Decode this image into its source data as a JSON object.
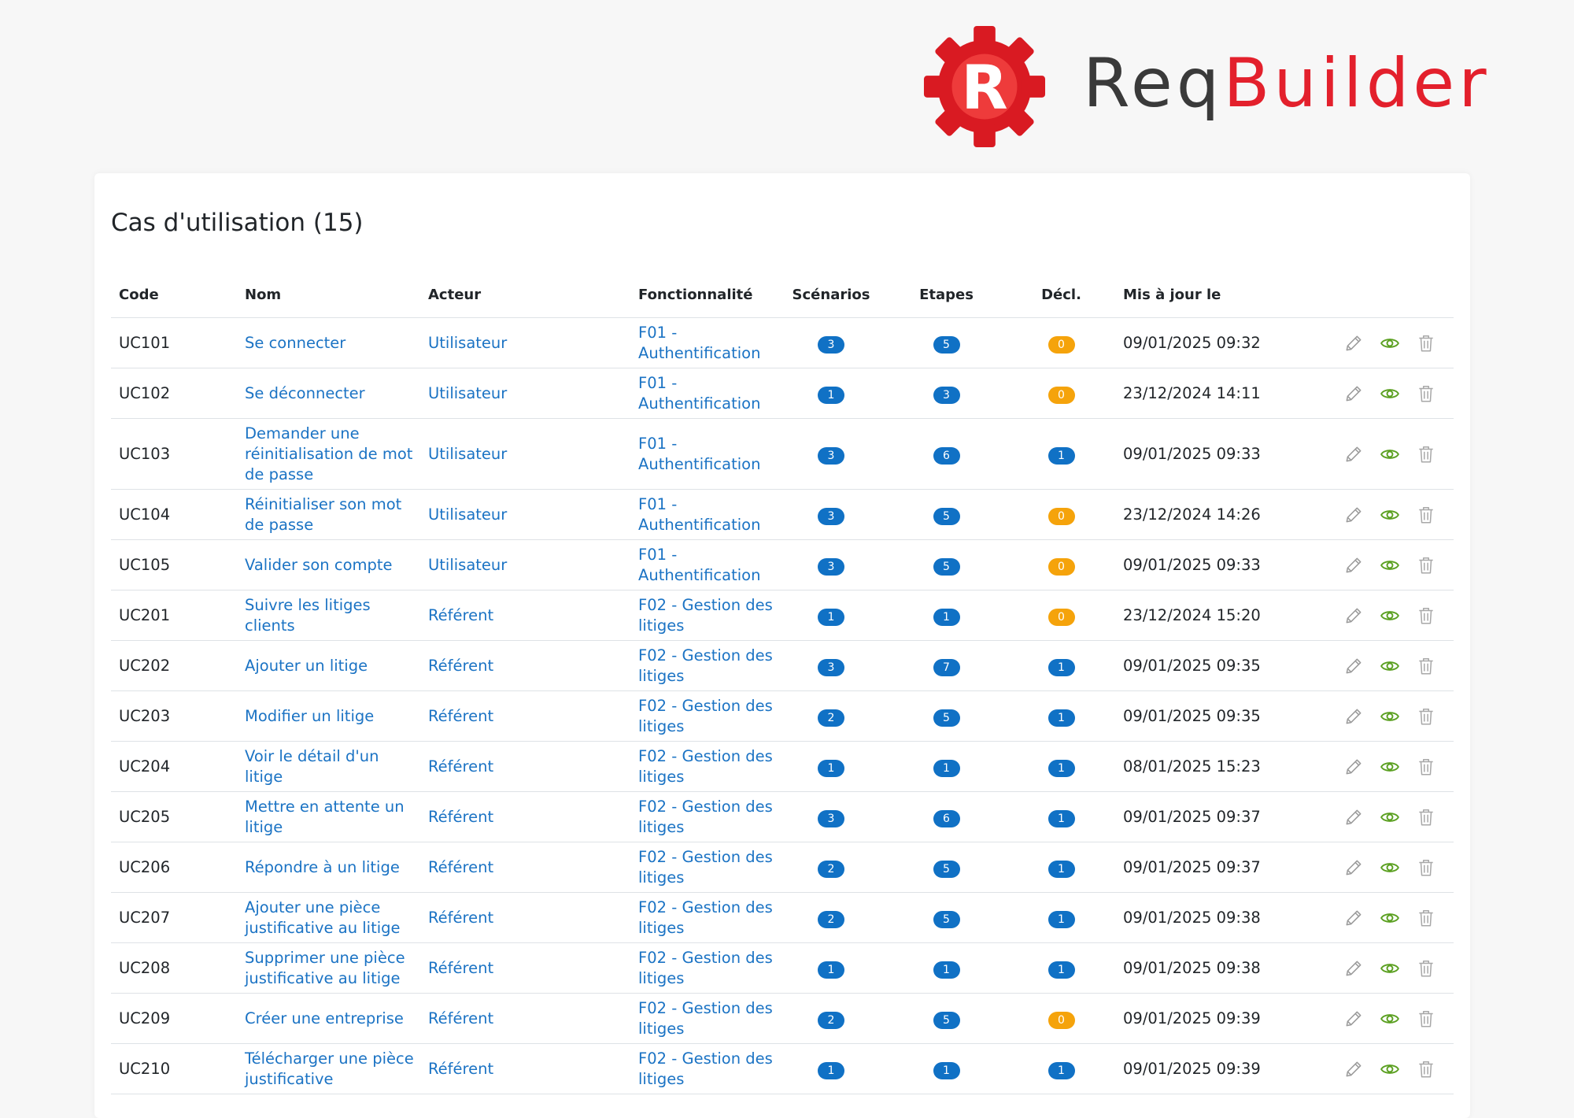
{
  "brand": {
    "req": "Req",
    "builder": "Builder",
    "letter": "R",
    "red": "#e3202c",
    "dark": "#3a3a3a"
  },
  "colors": {
    "link": "#1b73c4",
    "badge_blue": "#1071c5",
    "badge_orange": "#f5a30b",
    "view_green": "#5ba021"
  },
  "page": {
    "title": "Cas d'utilisation (15)"
  },
  "table": {
    "headers": [
      "Code",
      "Nom",
      "Acteur",
      "Fonctionnalité",
      "Scénarios",
      "Etapes",
      "Décl.",
      "Mis à jour le"
    ],
    "rows": [
      {
        "code": "UC101",
        "name": "Se connecter",
        "actor": "Utilisateur",
        "feature": "F01 - Authentification",
        "scenarios": "3",
        "steps": "5",
        "decl": "0",
        "updated": "09/01/2025 09:32"
      },
      {
        "code": "UC102",
        "name": "Se déconnecter",
        "actor": "Utilisateur",
        "feature": "F01 - Authentification",
        "scenarios": "1",
        "steps": "3",
        "decl": "0",
        "updated": "23/12/2024 14:11"
      },
      {
        "code": "UC103",
        "name": "Demander une réinitialisation de mot de passe",
        "actor": "Utilisateur",
        "feature": "F01 - Authentification",
        "scenarios": "3",
        "steps": "6",
        "decl": "1",
        "updated": "09/01/2025 09:33"
      },
      {
        "code": "UC104",
        "name": "Réinitialiser son mot de passe",
        "actor": "Utilisateur",
        "feature": "F01 - Authentification",
        "scenarios": "3",
        "steps": "5",
        "decl": "0",
        "updated": "23/12/2024 14:26"
      },
      {
        "code": "UC105",
        "name": "Valider son compte",
        "actor": "Utilisateur",
        "feature": "F01 - Authentification",
        "scenarios": "3",
        "steps": "5",
        "decl": "0",
        "updated": "09/01/2025 09:33"
      },
      {
        "code": "UC201",
        "name": "Suivre les litiges clients",
        "actor": "Référent",
        "feature": "F02 - Gestion des litiges",
        "scenarios": "1",
        "steps": "1",
        "decl": "0",
        "updated": "23/12/2024 15:20"
      },
      {
        "code": "UC202",
        "name": "Ajouter un litige",
        "actor": "Référent",
        "feature": "F02 - Gestion des litiges",
        "scenarios": "3",
        "steps": "7",
        "decl": "1",
        "updated": "09/01/2025 09:35"
      },
      {
        "code": "UC203",
        "name": "Modifier un litige",
        "actor": "Référent",
        "feature": "F02 - Gestion des litiges",
        "scenarios": "2",
        "steps": "5",
        "decl": "1",
        "updated": "09/01/2025 09:35"
      },
      {
        "code": "UC204",
        "name": "Voir le détail d'un litige",
        "actor": "Référent",
        "feature": "F02 - Gestion des litiges",
        "scenarios": "1",
        "steps": "1",
        "decl": "1",
        "updated": "08/01/2025 15:23"
      },
      {
        "code": "UC205",
        "name": "Mettre en attente un litige",
        "actor": "Référent",
        "feature": "F02 - Gestion des litiges",
        "scenarios": "3",
        "steps": "6",
        "decl": "1",
        "updated": "09/01/2025 09:37"
      },
      {
        "code": "UC206",
        "name": "Répondre à un litige",
        "actor": "Référent",
        "feature": "F02 - Gestion des litiges",
        "scenarios": "2",
        "steps": "5",
        "decl": "1",
        "updated": "09/01/2025 09:37"
      },
      {
        "code": "UC207",
        "name": "Ajouter une pièce justificative au litige",
        "actor": "Référent",
        "feature": "F02 - Gestion des litiges",
        "scenarios": "2",
        "steps": "5",
        "decl": "1",
        "updated": "09/01/2025 09:38"
      },
      {
        "code": "UC208",
        "name": "Supprimer une pièce justificative au litige",
        "actor": "Référent",
        "feature": "F02 - Gestion des litiges",
        "scenarios": "1",
        "steps": "1",
        "decl": "1",
        "updated": "09/01/2025 09:38"
      },
      {
        "code": "UC209",
        "name": "Créer une entreprise",
        "actor": "Référent",
        "feature": "F02 - Gestion des litiges",
        "scenarios": "2",
        "steps": "5",
        "decl": "0",
        "updated": "09/01/2025 09:39"
      },
      {
        "code": "UC210",
        "name": "Télécharger une pièce justificative",
        "actor": "Référent",
        "feature": "F02 - Gestion des litiges",
        "scenarios": "1",
        "steps": "1",
        "decl": "1",
        "updated": "09/01/2025 09:39"
      }
    ],
    "row_icons": [
      "edit-icon",
      "view-icon",
      "delete-icon"
    ]
  }
}
